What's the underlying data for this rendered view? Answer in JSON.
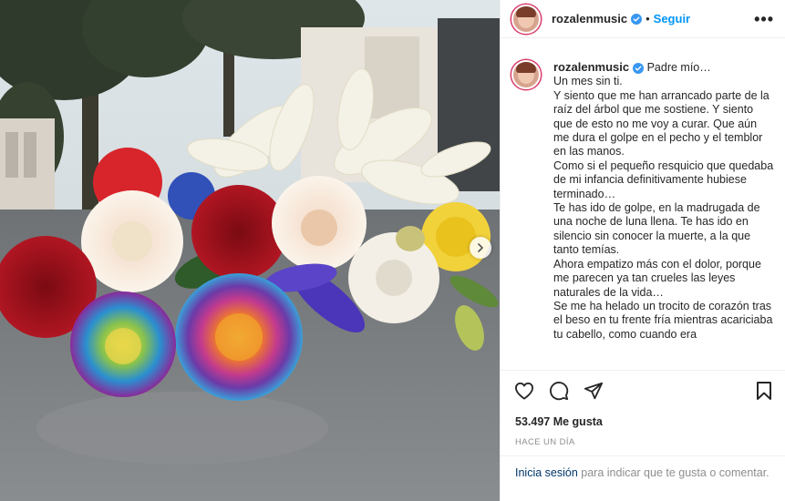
{
  "post": {
    "username": "rozalenmusic",
    "follow_label": "Seguir",
    "more_label": "•••",
    "caption_first_line": "Padre mío…",
    "caption_body": "Un mes sin ti.\nY siento que me han arrancado parte de la raíz del árbol que me sostiene. Y siento que de esto no me voy a curar. Que aún me dura el golpe en el pecho y el temblor en las manos.\nComo si el pequeño resquicio que quedaba de mi infancia definitivamente hubiese terminado…\nTe has ido de golpe, en la madrugada de una noche de luna llena. Te has ido en silencio sin conocer la muerte, a la que tanto temías.\nAhora empatizo más con el dolor, porque me parecen ya tan crueles las leyes naturales de la vida…\nSe me ha helado un trocito de corazón tras el beso en tu frente fría mientras acariciaba tu cabello, como cuando era",
    "likes": "53.497 Me gusta",
    "timestamp": "HACE UN DÍA",
    "login_link": "Inicia sesión",
    "login_text": " para indicar que te gusta o comentar."
  },
  "icons": {
    "verified": "verified-badge-icon",
    "like": "heart-icon",
    "comment": "comment-bubble-icon",
    "share": "paper-plane-icon",
    "save": "bookmark-icon",
    "next": "chevron-right-icon"
  },
  "colors": {
    "link": "#0095f6",
    "verified": "#3897f0",
    "muted": "#8e8e8e",
    "text": "#262626"
  }
}
